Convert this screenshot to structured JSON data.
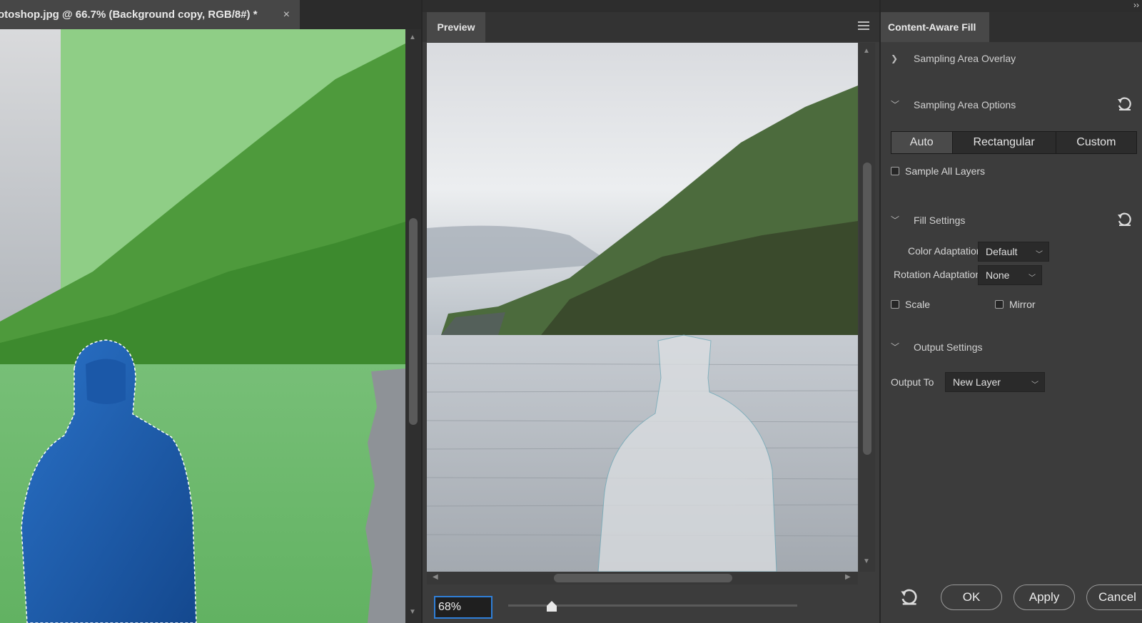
{
  "document": {
    "tab_title": "otoshop.jpg @ 66.7% (Background copy, RGB/8#) *",
    "close_glyph": "×"
  },
  "preview": {
    "tab_label": "Preview",
    "zoom_value": "68%",
    "zoom_slider_fraction": 0.15
  },
  "panel": {
    "collapse_glyph": "››",
    "tab_label": "Content-Aware Fill",
    "sampling_overlay": {
      "label": "Sampling Area Overlay",
      "expanded": false
    },
    "sampling_options": {
      "label": "Sampling Area Options",
      "expanded": true,
      "segments": [
        {
          "label": "Auto",
          "active": true
        },
        {
          "label": "Rectangular",
          "active": false
        },
        {
          "label": "Custom",
          "active": false
        }
      ],
      "sample_all_layers_label": "Sample All Layers",
      "sample_all_layers_checked": false
    },
    "fill_settings": {
      "label": "Fill Settings",
      "expanded": true,
      "color_adaptation_label": "Color Adaptation",
      "color_adaptation_value": "Default",
      "rotation_adaptation_label": "Rotation Adaptation",
      "rotation_adaptation_value": "None",
      "scale_label": "Scale",
      "scale_checked": false,
      "mirror_label": "Mirror",
      "mirror_checked": false
    },
    "output_settings": {
      "label": "Output Settings",
      "expanded": true,
      "output_to_label": "Output To",
      "output_to_value": "New Layer"
    },
    "footer": {
      "ok_label": "OK",
      "apply_label": "Apply",
      "cancel_label": "Cancel"
    }
  },
  "colors": {
    "panel_bg": "#3c3c3c",
    "accent_blue": "#2f7fd8",
    "sampling_overlay_green": "#4fb84f",
    "jacket_blue": "#1f5fb0"
  },
  "icons": {
    "chevron_right": "chevron-right-icon",
    "chevron_down": "chevron-down-icon",
    "reset": "reset-icon",
    "panel_menu": "hamburger-menu-icon"
  }
}
